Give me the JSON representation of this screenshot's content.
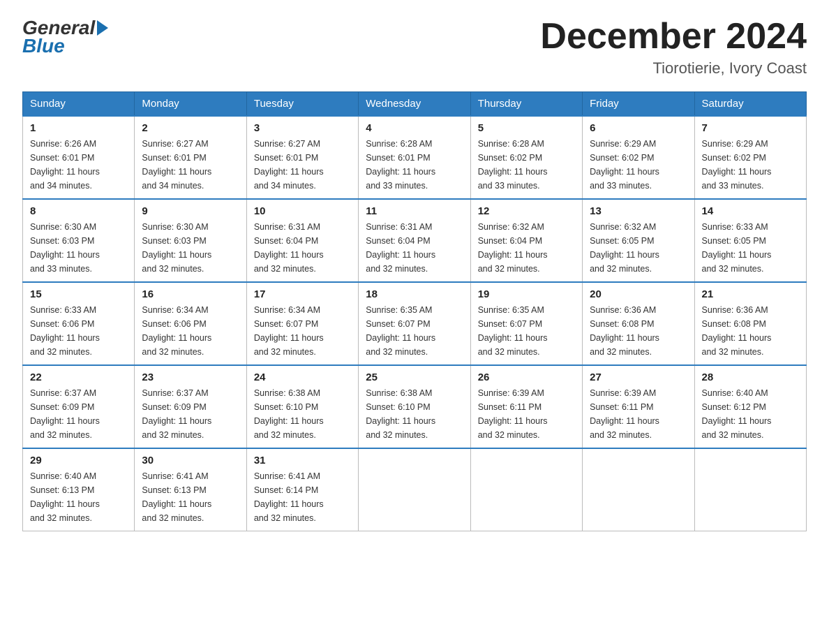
{
  "logo": {
    "general": "General",
    "blue": "Blue"
  },
  "header": {
    "month_year": "December 2024",
    "location": "Tiorotierie, Ivory Coast"
  },
  "days_of_week": [
    "Sunday",
    "Monday",
    "Tuesday",
    "Wednesday",
    "Thursday",
    "Friday",
    "Saturday"
  ],
  "weeks": [
    [
      {
        "day": "1",
        "sunrise": "6:26 AM",
        "sunset": "6:01 PM",
        "daylight": "11 hours and 34 minutes."
      },
      {
        "day": "2",
        "sunrise": "6:27 AM",
        "sunset": "6:01 PM",
        "daylight": "11 hours and 34 minutes."
      },
      {
        "day": "3",
        "sunrise": "6:27 AM",
        "sunset": "6:01 PM",
        "daylight": "11 hours and 34 minutes."
      },
      {
        "day": "4",
        "sunrise": "6:28 AM",
        "sunset": "6:01 PM",
        "daylight": "11 hours and 33 minutes."
      },
      {
        "day": "5",
        "sunrise": "6:28 AM",
        "sunset": "6:02 PM",
        "daylight": "11 hours and 33 minutes."
      },
      {
        "day": "6",
        "sunrise": "6:29 AM",
        "sunset": "6:02 PM",
        "daylight": "11 hours and 33 minutes."
      },
      {
        "day": "7",
        "sunrise": "6:29 AM",
        "sunset": "6:02 PM",
        "daylight": "11 hours and 33 minutes."
      }
    ],
    [
      {
        "day": "8",
        "sunrise": "6:30 AM",
        "sunset": "6:03 PM",
        "daylight": "11 hours and 33 minutes."
      },
      {
        "day": "9",
        "sunrise": "6:30 AM",
        "sunset": "6:03 PM",
        "daylight": "11 hours and 32 minutes."
      },
      {
        "day": "10",
        "sunrise": "6:31 AM",
        "sunset": "6:04 PM",
        "daylight": "11 hours and 32 minutes."
      },
      {
        "day": "11",
        "sunrise": "6:31 AM",
        "sunset": "6:04 PM",
        "daylight": "11 hours and 32 minutes."
      },
      {
        "day": "12",
        "sunrise": "6:32 AM",
        "sunset": "6:04 PM",
        "daylight": "11 hours and 32 minutes."
      },
      {
        "day": "13",
        "sunrise": "6:32 AM",
        "sunset": "6:05 PM",
        "daylight": "11 hours and 32 minutes."
      },
      {
        "day": "14",
        "sunrise": "6:33 AM",
        "sunset": "6:05 PM",
        "daylight": "11 hours and 32 minutes."
      }
    ],
    [
      {
        "day": "15",
        "sunrise": "6:33 AM",
        "sunset": "6:06 PM",
        "daylight": "11 hours and 32 minutes."
      },
      {
        "day": "16",
        "sunrise": "6:34 AM",
        "sunset": "6:06 PM",
        "daylight": "11 hours and 32 minutes."
      },
      {
        "day": "17",
        "sunrise": "6:34 AM",
        "sunset": "6:07 PM",
        "daylight": "11 hours and 32 minutes."
      },
      {
        "day": "18",
        "sunrise": "6:35 AM",
        "sunset": "6:07 PM",
        "daylight": "11 hours and 32 minutes."
      },
      {
        "day": "19",
        "sunrise": "6:35 AM",
        "sunset": "6:07 PM",
        "daylight": "11 hours and 32 minutes."
      },
      {
        "day": "20",
        "sunrise": "6:36 AM",
        "sunset": "6:08 PM",
        "daylight": "11 hours and 32 minutes."
      },
      {
        "day": "21",
        "sunrise": "6:36 AM",
        "sunset": "6:08 PM",
        "daylight": "11 hours and 32 minutes."
      }
    ],
    [
      {
        "day": "22",
        "sunrise": "6:37 AM",
        "sunset": "6:09 PM",
        "daylight": "11 hours and 32 minutes."
      },
      {
        "day": "23",
        "sunrise": "6:37 AM",
        "sunset": "6:09 PM",
        "daylight": "11 hours and 32 minutes."
      },
      {
        "day": "24",
        "sunrise": "6:38 AM",
        "sunset": "6:10 PM",
        "daylight": "11 hours and 32 minutes."
      },
      {
        "day": "25",
        "sunrise": "6:38 AM",
        "sunset": "6:10 PM",
        "daylight": "11 hours and 32 minutes."
      },
      {
        "day": "26",
        "sunrise": "6:39 AM",
        "sunset": "6:11 PM",
        "daylight": "11 hours and 32 minutes."
      },
      {
        "day": "27",
        "sunrise": "6:39 AM",
        "sunset": "6:11 PM",
        "daylight": "11 hours and 32 minutes."
      },
      {
        "day": "28",
        "sunrise": "6:40 AM",
        "sunset": "6:12 PM",
        "daylight": "11 hours and 32 minutes."
      }
    ],
    [
      {
        "day": "29",
        "sunrise": "6:40 AM",
        "sunset": "6:13 PM",
        "daylight": "11 hours and 32 minutes."
      },
      {
        "day": "30",
        "sunrise": "6:41 AM",
        "sunset": "6:13 PM",
        "daylight": "11 hours and 32 minutes."
      },
      {
        "day": "31",
        "sunrise": "6:41 AM",
        "sunset": "6:14 PM",
        "daylight": "11 hours and 32 minutes."
      },
      null,
      null,
      null,
      null
    ]
  ],
  "labels": {
    "sunrise": "Sunrise:",
    "sunset": "Sunset:",
    "daylight": "Daylight:"
  }
}
